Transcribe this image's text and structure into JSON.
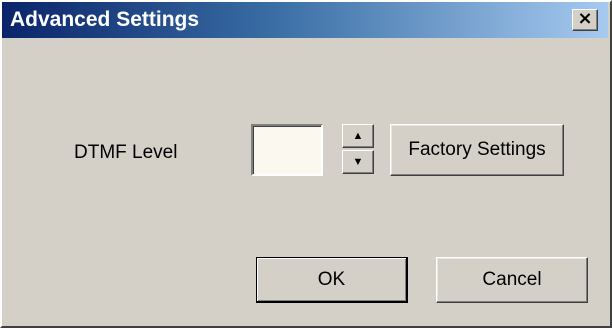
{
  "window": {
    "title": "Advanced Settings",
    "close_label": "×"
  },
  "colors": {
    "titlebar_start": "#0a246a",
    "titlebar_end": "#a6caf0",
    "dialog_bg": "#d4d0c8",
    "input_bg": "#fbf8ef"
  },
  "dtmf": {
    "label": "DTMF Level",
    "value": "",
    "spin_up_glyph": "▲",
    "spin_down_glyph": "▼"
  },
  "buttons": {
    "factory_settings": "Factory Settings",
    "ok": "OK",
    "cancel": "Cancel"
  },
  "icons": {
    "close": "close-icon",
    "spin_up": "arrow-up-icon",
    "spin_down": "arrow-down-icon"
  }
}
